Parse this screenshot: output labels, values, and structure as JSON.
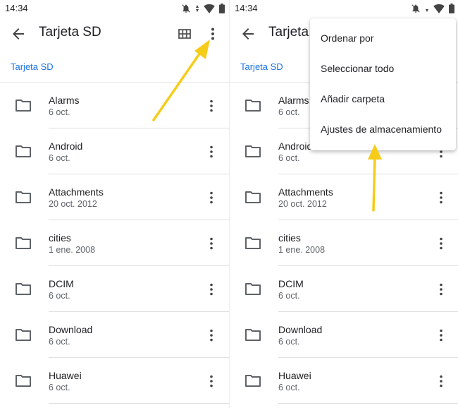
{
  "colors": {
    "accent": "#1a73e8",
    "text_primary": "#202124",
    "text_secondary": "#5f6368",
    "arrow": "#f6cc1a"
  },
  "left": {
    "status": {
      "time": "14:34"
    },
    "app_bar": {
      "title": "Tarjeta SD",
      "back_icon": "arrow-back-icon",
      "grid_icon": "grid-view-icon",
      "more_icon": "more-vert-icon"
    },
    "breadcrumb": "Tarjeta SD",
    "items": [
      {
        "name": "Alarms",
        "date": "6 oct."
      },
      {
        "name": "Android",
        "date": "6 oct."
      },
      {
        "name": "Attachments",
        "date": "20 oct. 2012"
      },
      {
        "name": "cities",
        "date": "1 ene. 2008"
      },
      {
        "name": "DCIM",
        "date": "6 oct."
      },
      {
        "name": "Download",
        "date": "6 oct."
      },
      {
        "name": "Huawei",
        "date": "6 oct."
      }
    ]
  },
  "right": {
    "status": {
      "time": "14:34"
    },
    "app_bar": {
      "title": "Tarjeta SD"
    },
    "breadcrumb": "Tarjeta SD",
    "items": [
      {
        "name": "Alarms",
        "date": "6 oct."
      },
      {
        "name": "Android",
        "date": "6 oct."
      },
      {
        "name": "Attachments",
        "date": "20 oct. 2012"
      },
      {
        "name": "cities",
        "date": "1 ene. 2008"
      },
      {
        "name": "DCIM",
        "date": "6 oct."
      },
      {
        "name": "Download",
        "date": "6 oct."
      },
      {
        "name": "Huawei",
        "date": "6 oct."
      }
    ],
    "menu": {
      "items": [
        "Ordenar por",
        "Seleccionar todo",
        "Añadir carpeta",
        "Ajustes de almacenamiento"
      ]
    }
  }
}
